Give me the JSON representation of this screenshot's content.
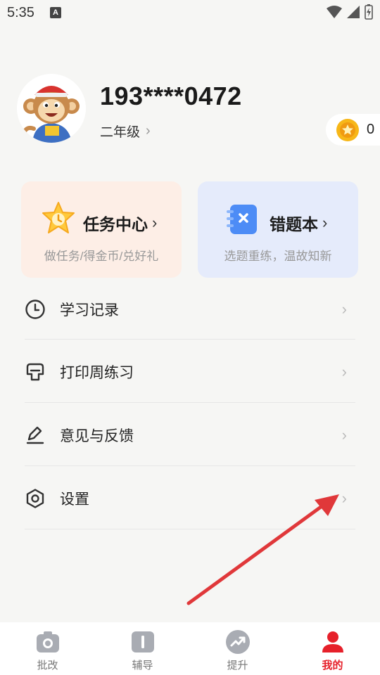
{
  "status_bar": {
    "time": "5:35",
    "notification_letter": "A"
  },
  "profile": {
    "phone": "193****0472",
    "grade": "二年级",
    "coins": "0"
  },
  "cards": {
    "task": {
      "title": "任务中心",
      "subtitle": "做任务/得金币/兑好礼"
    },
    "wrong_book": {
      "title": "错题本",
      "subtitle": "选题重练，温故知新"
    }
  },
  "menu": [
    {
      "label": "学习记录",
      "icon": "clock-icon"
    },
    {
      "label": "打印周练习",
      "icon": "print-icon"
    },
    {
      "label": "意见与反馈",
      "icon": "edit-icon"
    },
    {
      "label": "设置",
      "icon": "hexagon-settings-icon"
    }
  ],
  "nav": [
    {
      "label": "批改",
      "icon": "camera-icon"
    },
    {
      "label": "辅导",
      "icon": "book-icon"
    },
    {
      "label": "提升",
      "icon": "trend-icon"
    },
    {
      "label": "我的",
      "icon": "person-icon",
      "active": true
    }
  ],
  "colors": {
    "accent": "#e6202a",
    "task_card_bg": "#fdeee6",
    "wrong_card_bg": "#e5ebfb",
    "annotation_arrow": "#e0383a"
  }
}
